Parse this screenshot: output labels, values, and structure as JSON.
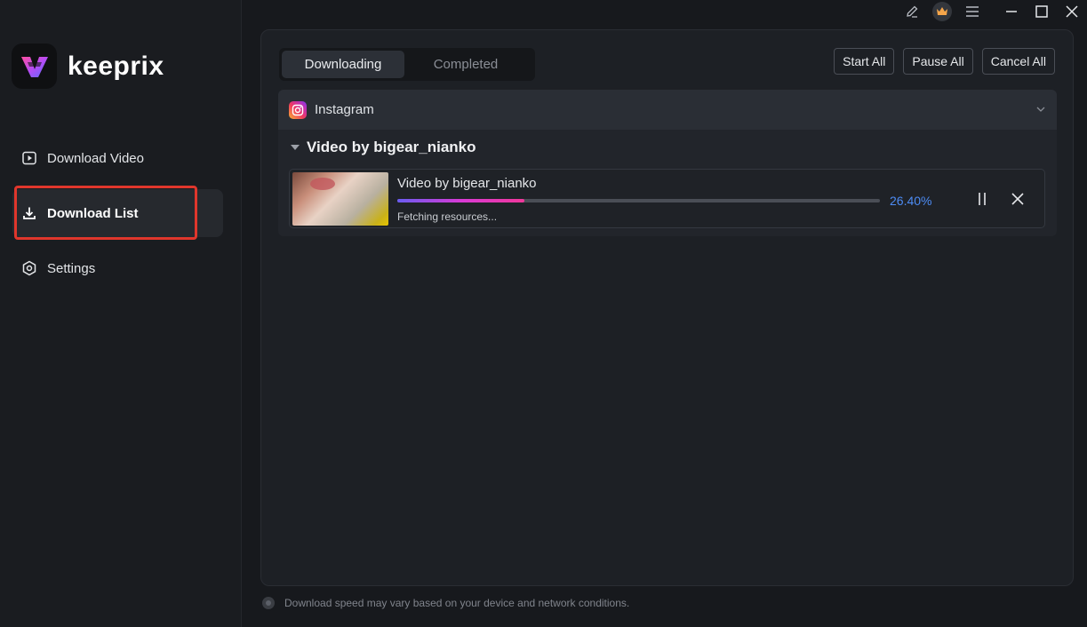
{
  "app": {
    "name": "keeprix",
    "colors": {
      "accent": "#4d8cf5",
      "highlight": "#e0362c",
      "background": "#17191d"
    }
  },
  "titlebar": {
    "icons": [
      "edit-icon",
      "crown-icon",
      "menu-icon",
      "minimize-icon",
      "maximize-icon",
      "close-icon"
    ]
  },
  "sidebar": {
    "items": [
      {
        "label": "Download Video",
        "icon": "play-icon",
        "active": false
      },
      {
        "label": "Download List",
        "icon": "download-icon",
        "active": true
      },
      {
        "label": "Settings",
        "icon": "gear-icon",
        "active": false
      }
    ]
  },
  "tabs": [
    {
      "label": "Downloading",
      "active": true
    },
    {
      "label": "Completed",
      "active": false
    }
  ],
  "actions": {
    "start_all": "Start All",
    "pause_all": "Pause All",
    "cancel_all": "Cancel All"
  },
  "group": {
    "platform": "Instagram",
    "title": "Video by bigear_nianko",
    "item": {
      "name": "Video by bigear_nianko",
      "progress_percent": 26.4,
      "progress_text": "26.40%",
      "status": "Fetching resources..."
    }
  },
  "footer": {
    "note": "Download speed may vary based on your device and network conditions."
  }
}
